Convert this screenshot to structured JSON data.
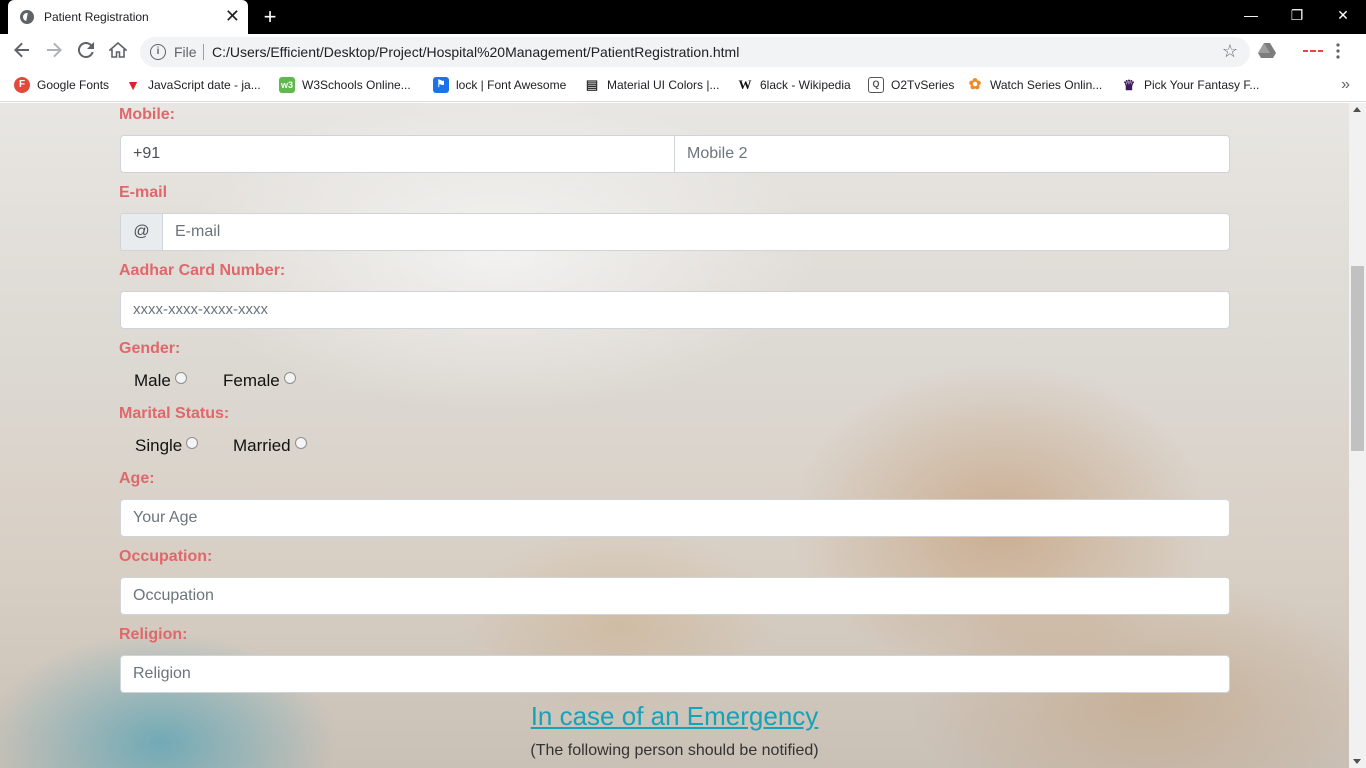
{
  "browser": {
    "tab_title": "Patient Registration",
    "tab_close": "✕",
    "new_tab": "+",
    "window_controls": [
      "—",
      "❐",
      "✕"
    ],
    "address_prefix": "File",
    "url": "C:/Users/Efficient/Desktop/Project/Hospital%20Management/PatientRegistration.html"
  },
  "bookmarks": [
    {
      "label": "Google Fonts",
      "icon": "google-fonts-icon",
      "glyph": "F",
      "color": "#e5483b"
    },
    {
      "label": "JavaScript date - ja...",
      "icon": "javascript-icon",
      "glyph": "▼",
      "color": "#e0202b"
    },
    {
      "label": "W3Schools Online...",
      "icon": "w3schools-icon",
      "glyph": "w3",
      "color": "#5fb94c"
    },
    {
      "label": "lock | Font Awesome",
      "icon": "font-awesome-icon",
      "glyph": "⚑",
      "color": "#1a73e8"
    },
    {
      "label": "Material UI Colors |...",
      "icon": "material-colors-icon",
      "glyph": "▤",
      "color": "#333333"
    },
    {
      "label": "6lack - Wikipedia",
      "icon": "wikipedia-icon",
      "glyph": "W",
      "color": "#ffffff"
    },
    {
      "label": "O2TvSeries",
      "icon": "o2tvseries-icon",
      "glyph": "Q",
      "color": "#555555"
    },
    {
      "label": "Watch Series Onlin...",
      "icon": "watch-series-icon",
      "glyph": "✿",
      "color": "#f08a24"
    },
    {
      "label": "Pick Your Fantasy F...",
      "icon": "premier-league-icon",
      "glyph": "♛",
      "color": "#3d195b"
    }
  ],
  "form": {
    "mobile": {
      "label": "Mobile:",
      "value1": "+91",
      "placeholder2": "Mobile 2"
    },
    "email": {
      "label": "E-mail",
      "addon": "@",
      "placeholder": "E-mail"
    },
    "aadhar": {
      "label": "Aadhar Card Number:",
      "placeholder": "xxxx-xxxx-xxxx-xxxx"
    },
    "gender": {
      "label": "Gender:",
      "options": [
        "Male",
        "Female"
      ]
    },
    "marital": {
      "label": "Marital Status:",
      "options": [
        "Single",
        "Married"
      ]
    },
    "age": {
      "label": "Age:",
      "placeholder": "Your Age"
    },
    "occupation": {
      "label": "Occupation:",
      "placeholder": "Occupation"
    },
    "religion": {
      "label": "Religion:",
      "placeholder": "Religion"
    }
  },
  "emergency": {
    "heading": "In case of an Emergency",
    "subheading": "(The following person should be notified)"
  },
  "colors": {
    "label": "#e0676b",
    "emergency_link": "#17a2b8"
  }
}
